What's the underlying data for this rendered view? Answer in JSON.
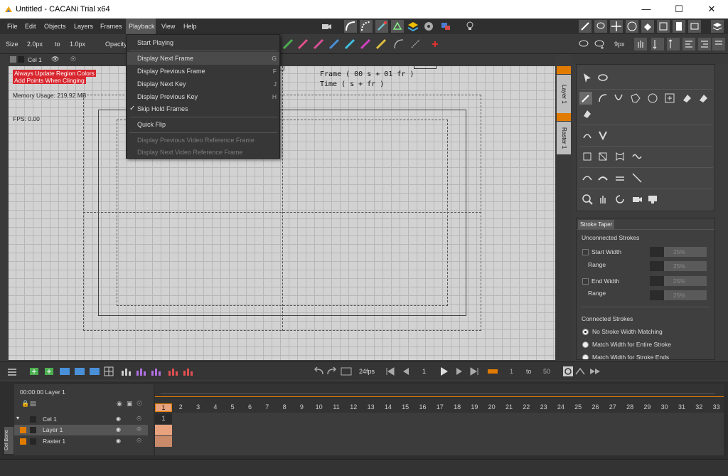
{
  "window": {
    "title": "Untitled - CACANi Trial  x64",
    "minimize": "—",
    "maximize": "☐",
    "close": "✕"
  },
  "menubar": {
    "items": [
      "File",
      "Edit",
      "Objects",
      "Layers",
      "Frames",
      "Playback",
      "View",
      "Help"
    ]
  },
  "toolbar": {
    "size_label": "Size",
    "size_from": "2.0px",
    "to_label": "to",
    "size_to": "1.0px",
    "opacity_label": "Opacity",
    "px_value": "9px"
  },
  "canvas_header": {
    "cel_label": "Cel 1"
  },
  "playback_menu": {
    "items": [
      {
        "label": "Start Playing",
        "key": ""
      },
      {
        "label": "Display Next Frame",
        "key": "G"
      },
      {
        "label": "Display Previous Frame",
        "key": "F"
      },
      {
        "label": "Display Next Key",
        "key": "J"
      },
      {
        "label": "Display Previous Key",
        "key": "H"
      },
      {
        "label": "Skip Hold Frames",
        "key": ""
      },
      {
        "label": "Quick Flip",
        "key": ""
      },
      {
        "label": "Display Previous Video Reference Frame",
        "key": ""
      },
      {
        "label": "Display Next Video Reference Frame",
        "key": ""
      }
    ]
  },
  "canvas": {
    "badge_1": "Always Update Region Colors",
    "badge_2": "Add Points When Clinging",
    "memory": "Memory Usage: 219.92 MB",
    "fps": "FPS: 0.00",
    "frame_line": "Frame ( 00 s + 01 fr )",
    "time_line": "Time (       s +       fr )"
  },
  "layer_strip": {
    "layer_tab": "Layer 1",
    "raster_tab": "Raster 1"
  },
  "stroke_taper": {
    "tab": "Stroke Taper",
    "unconnected_heading": "Unconnected Strokes",
    "start_width_label": "Start Width",
    "start_width_value": "25%",
    "range_label_1": "Range",
    "range_value_1": "25%",
    "end_width_label": "End Width",
    "end_width_value": "25%",
    "range_label_2": "Range",
    "range_value_2": "25%",
    "connected_heading": "Connected Strokes",
    "radio_1": "No Stroke Width Matching",
    "radio_2": "Match Width for Entire Stroke",
    "radio_3": "Match Width for Stroke Ends",
    "slider_fill": 0.25
  },
  "playback_bar": {
    "fps": "24fps",
    "current_frame": "1",
    "range_start": "1",
    "range_to": "to",
    "range_end": "50"
  },
  "timeline": {
    "time_label": "00:00:00  Layer 1",
    "layers": [
      {
        "name": "Cel 1",
        "color": "#262626"
      },
      {
        "name": "Layer 1",
        "color": "#e07b00"
      },
      {
        "name": "Raster 1",
        "color": "#e07b00"
      }
    ],
    "frame_numbers": [
      "1",
      "2",
      "3",
      "4",
      "5",
      "6",
      "7",
      "8",
      "9",
      "10",
      "11",
      "12",
      "13",
      "14",
      "15",
      "16",
      "17",
      "18",
      "19",
      "20",
      "21",
      "22",
      "23",
      "24",
      "25",
      "26",
      "27",
      "28",
      "29",
      "30",
      "31",
      "32",
      "33"
    ],
    "cell_label": "1",
    "cel_bone_tab": "Cel Bone"
  },
  "colors": {
    "accent_orange": "#e07b00",
    "badge_red": "#d8262e",
    "canvas_bg": "#d2d2d2"
  }
}
